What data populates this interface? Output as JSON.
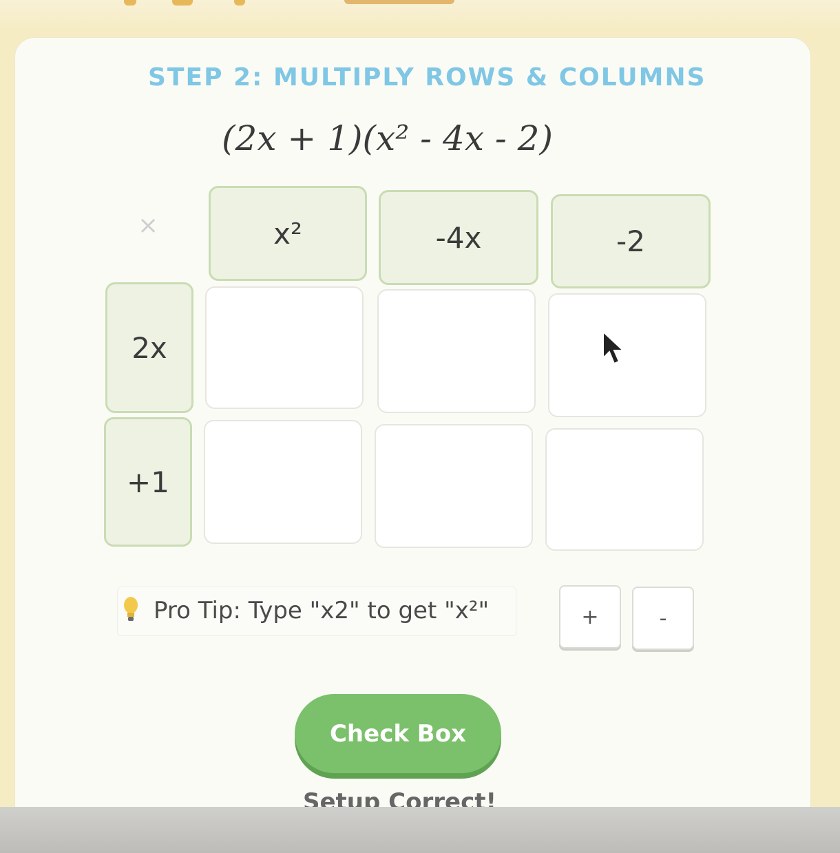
{
  "step_title": "STEP 2: MULTIPLY ROWS & COLUMNS",
  "equation": "(2x + 1)(x² - 4x - 2)",
  "grid": {
    "corner_symbol": "×",
    "column_headers": [
      "x²",
      "-4x",
      "-2"
    ],
    "row_headers": [
      "2x",
      "+1"
    ],
    "cells": [
      [
        "",
        "",
        ""
      ],
      [
        "",
        "",
        ""
      ]
    ]
  },
  "tip": {
    "icon": "lightbulb-icon",
    "text": "Pro Tip: Type \"x2\" to get \"x²\""
  },
  "buttons": {
    "plus_label": "+",
    "minus_label": "-",
    "check_label": "Check Box"
  },
  "status_text": "Setup Correct!",
  "colors": {
    "title": "#7fc7e4",
    "header_fill": "#eef2e3",
    "header_border": "#c9dcb3",
    "check_button": "#7bc06b",
    "page_background": "#f6ecc3"
  }
}
